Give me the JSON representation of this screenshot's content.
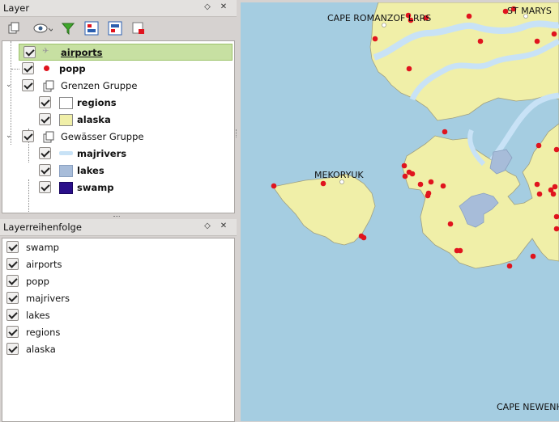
{
  "layer_panel": {
    "title": "Layer",
    "float_icon": "float-icon",
    "close_icon": "close-icon"
  },
  "toolbar": [
    "add-group-icon",
    "visibility-icon",
    "filter-icon",
    "expand-all-icon",
    "collapse-all-icon",
    "remove-layer-icon"
  ],
  "layers": {
    "airports": "airports",
    "popp": "popp",
    "grenzen_group": "Grenzen Gruppe",
    "regions": "regions",
    "alaska": "alaska",
    "gewaesser_group": "Gewässer Gruppe",
    "majrivers": "majrivers",
    "lakes": "lakes",
    "swamp": "swamp"
  },
  "order_panel": {
    "title": "Layerreihenfolge",
    "items": [
      "swamp",
      "airports",
      "popp",
      "majrivers",
      "lakes",
      "regions",
      "alaska"
    ]
  },
  "map": {
    "labels": {
      "cape_romanzof": "CAPE ROMANZOF LRRS",
      "st_marys": "ST MARYS",
      "mekoryuk": "MEKORYUK",
      "cape_newenham": "CAPE NEWENH"
    }
  },
  "colors": {
    "water": "#a5cde1",
    "land": "#f0efa8",
    "point": "#e0141e",
    "river": "#c8e2f6",
    "lake": "#a7bcd9",
    "swamp": "#2a0f8a",
    "selected": "#c7e0a2"
  }
}
